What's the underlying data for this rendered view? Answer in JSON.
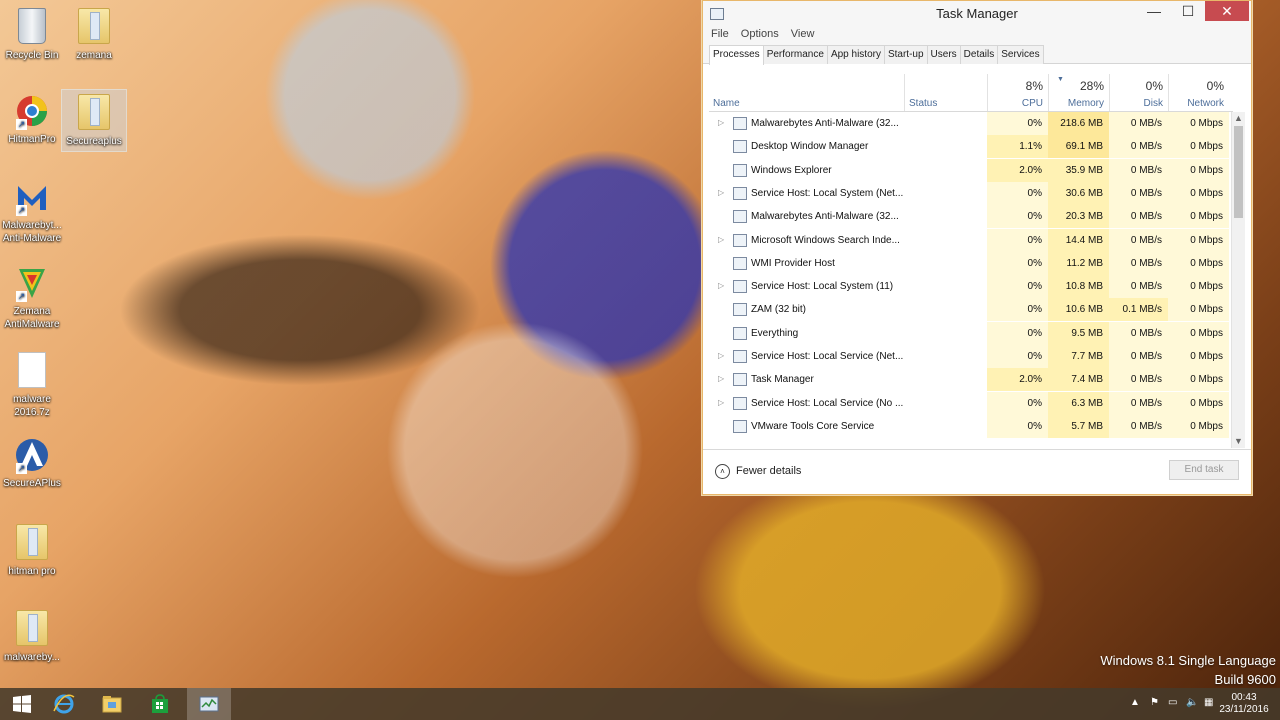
{
  "desktop": {
    "icons": [
      {
        "label": "Recycle Bin",
        "icon": "recycle-bin-icon"
      },
      {
        "label": "zemana",
        "icon": "folder-icon"
      },
      {
        "label": "HitmanPro",
        "icon": "hitmanpro-icon"
      },
      {
        "label": "Secureaplus",
        "icon": "folder-icon"
      },
      {
        "label": "Malwarebyt... Anti-Malware",
        "icon": "malwarebytes-icon"
      },
      {
        "label": "Zemana AntiMalware",
        "icon": "zemana-icon"
      },
      {
        "label": "malware 2016.7z",
        "icon": "file-icon"
      },
      {
        "label": "SecureAPlus",
        "icon": "secureaplus-icon"
      },
      {
        "label": "hitman pro",
        "icon": "folder-icon"
      },
      {
        "label": "malwareby...",
        "icon": "folder-icon"
      }
    ]
  },
  "task_manager": {
    "title": "Task Manager",
    "window_buttons": {
      "minimize": "—",
      "maximize": "☐",
      "close": "✕"
    },
    "menu": [
      "File",
      "Options",
      "View"
    ],
    "tabs": [
      "Processes",
      "Performance",
      "App history",
      "Start-up",
      "Users",
      "Details",
      "Services"
    ],
    "active_tab": "Processes",
    "columns": {
      "name": "Name",
      "status": "Status",
      "cpu": {
        "label": "CPU",
        "total": "8%"
      },
      "memory": {
        "label": "Memory",
        "total": "28%"
      },
      "disk": {
        "label": "Disk",
        "total": "0%"
      },
      "network": {
        "label": "Network",
        "total": "0%"
      }
    },
    "processes": [
      {
        "name": "Malwarebytes Anti-Malware (32...",
        "expandable": true,
        "cpu": "0%",
        "memory": "218.6 MB",
        "disk": "0 MB/s",
        "network": "0 Mbps",
        "icon": "malwarebytes-window-icon"
      },
      {
        "name": "Desktop Window Manager",
        "expandable": false,
        "cpu": "1.1%",
        "memory": "69.1 MB",
        "disk": "0 MB/s",
        "network": "0 Mbps",
        "icon": "window-icon"
      },
      {
        "name": "Windows Explorer",
        "expandable": false,
        "cpu": "2.0%",
        "memory": "35.9 MB",
        "disk": "0 MB/s",
        "network": "0 Mbps",
        "icon": "folder-icon"
      },
      {
        "name": "Service Host: Local System (Net...",
        "expandable": true,
        "cpu": "0%",
        "memory": "30.6 MB",
        "disk": "0 MB/s",
        "network": "0 Mbps",
        "icon": "gear-icon"
      },
      {
        "name": "Malwarebytes Anti-Malware (32...",
        "expandable": false,
        "cpu": "0%",
        "memory": "20.3 MB",
        "disk": "0 MB/s",
        "network": "0 Mbps",
        "icon": "malwarebytes-icon"
      },
      {
        "name": "Microsoft Windows Search Inde...",
        "expandable": true,
        "cpu": "0%",
        "memory": "14.4 MB",
        "disk": "0 MB/s",
        "network": "0 Mbps",
        "icon": "search-indexer-icon"
      },
      {
        "name": "WMI Provider Host",
        "expandable": false,
        "cpu": "0%",
        "memory": "11.2 MB",
        "disk": "0 MB/s",
        "network": "0 Mbps",
        "icon": "wmi-icon"
      },
      {
        "name": "Service Host: Local System (11)",
        "expandable": true,
        "cpu": "0%",
        "memory": "10.8 MB",
        "disk": "0 MB/s",
        "network": "0 Mbps",
        "icon": "gear-icon"
      },
      {
        "name": "ZAM (32 bit)",
        "expandable": false,
        "cpu": "0%",
        "memory": "10.6 MB",
        "disk": "0.1 MB/s",
        "network": "0 Mbps",
        "icon": "zemana-icon"
      },
      {
        "name": "Everything",
        "expandable": false,
        "cpu": "0%",
        "memory": "9.5 MB",
        "disk": "0 MB/s",
        "network": "0 Mbps",
        "icon": "magnifier-icon"
      },
      {
        "name": "Service Host: Local Service (Net...",
        "expandable": true,
        "cpu": "0%",
        "memory": "7.7 MB",
        "disk": "0 MB/s",
        "network": "0 Mbps",
        "icon": "gear-icon"
      },
      {
        "name": "Task Manager",
        "expandable": true,
        "cpu": "2.0%",
        "memory": "7.4 MB",
        "disk": "0 MB/s",
        "network": "0 Mbps",
        "icon": "task-manager-icon"
      },
      {
        "name": "Service Host: Local Service (No ...",
        "expandable": true,
        "cpu": "0%",
        "memory": "6.3 MB",
        "disk": "0 MB/s",
        "network": "0 Mbps",
        "icon": "gear-icon"
      },
      {
        "name": "VMware Tools Core Service",
        "expandable": false,
        "cpu": "0%",
        "memory": "5.7 MB",
        "disk": "0 MB/s",
        "network": "0 Mbps",
        "icon": "vmware-icon"
      }
    ],
    "footer": {
      "fewer_details": "Fewer details",
      "end_task": "End task"
    }
  },
  "watermark": {
    "line1": "Windows 8.1 Single Language",
    "line2": "Build 9600"
  },
  "taskbar": {
    "items": [
      "start-button",
      "internet-explorer",
      "file-explorer",
      "windows-store",
      "task-manager"
    ],
    "clock": {
      "time": "00:43",
      "date": "23/11/2016"
    }
  }
}
